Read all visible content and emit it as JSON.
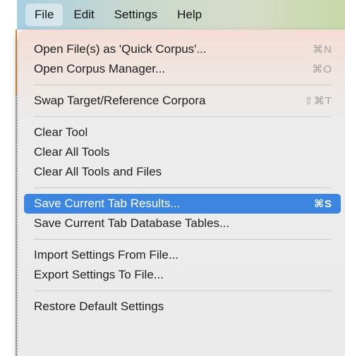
{
  "menubar": {
    "items": [
      {
        "label": "File"
      },
      {
        "label": "Edit"
      },
      {
        "label": "Settings"
      },
      {
        "label": "Help"
      }
    ]
  },
  "file_menu": {
    "open_quick_corpus": {
      "label": "Open File(s) as 'Quick Corpus'...",
      "shortcut": "⌘N"
    },
    "open_corpus_manager": {
      "label": "Open Corpus Manager...",
      "shortcut": "⌘O"
    },
    "swap_corpora": {
      "label": "Swap Target/Reference Corpora",
      "shortcut": "⇧⌘T"
    },
    "clear_tool": {
      "label": "Clear Tool"
    },
    "clear_all_tools": {
      "label": "Clear All Tools"
    },
    "clear_all_tools_files": {
      "label": "Clear All Tools and Files"
    },
    "save_tab_results": {
      "label": "Save Current Tab Results...",
      "shortcut": "⌘S"
    },
    "save_tab_db_tables": {
      "label": "Save Current Tab Database Tables..."
    },
    "import_settings": {
      "label": "Import Settings From File..."
    },
    "export_settings": {
      "label": "Export Settings To File..."
    },
    "restore_defaults": {
      "label": "Restore Default Settings"
    }
  },
  "colors": {
    "highlight": "#3c85e0",
    "menu_background": "#ebebeb",
    "shortcut_text": "#a0a0a0"
  }
}
